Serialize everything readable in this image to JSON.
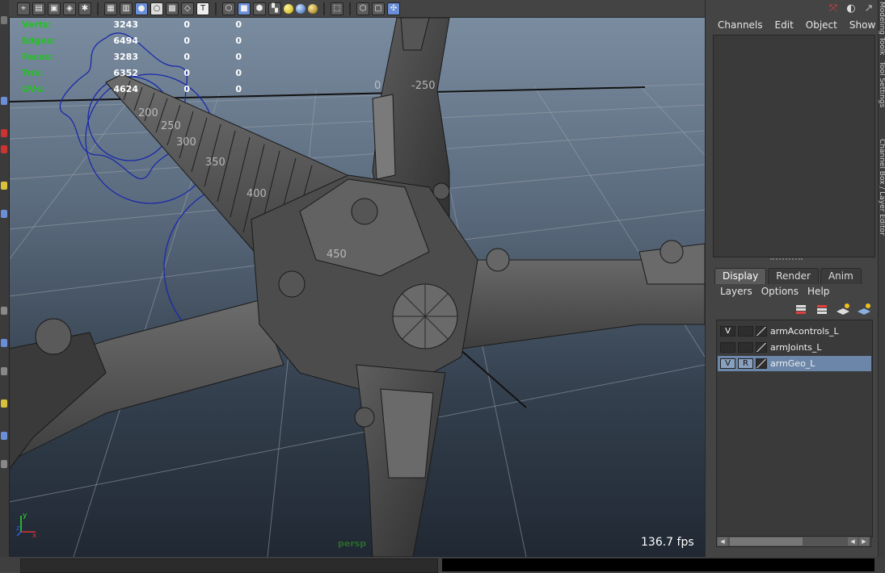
{
  "hud": {
    "stats": [
      {
        "label": "Verts:",
        "v1": "3243",
        "v2": "0",
        "v3": "0"
      },
      {
        "label": "Edges:",
        "v1": "6494",
        "v2": "0",
        "v3": "0"
      },
      {
        "label": "Faces:",
        "v1": "3283",
        "v2": "0",
        "v3": "0"
      },
      {
        "label": "Tris:",
        "v1": "6352",
        "v2": "0",
        "v3": "0"
      },
      {
        "label": "UVs:",
        "v1": "4624",
        "v2": "0",
        "v3": "0"
      }
    ],
    "fps": "136.7 fps",
    "camera": "persp"
  },
  "viewport": {
    "dimension_labels": [
      "-250",
      "250",
      "200",
      "300",
      "350",
      "400",
      "450",
      "0"
    ]
  },
  "toolbar": {
    "icons": [
      "select-camera-icon",
      "bookmark-icon",
      "image-plane-icon",
      "2d-pan-icon",
      "grid-icon",
      "wireframe-icon",
      "smooth-shade-icon",
      "wireframe-on-shaded-icon",
      "xray-icon",
      "texture-icon",
      "use-all-lights-icon",
      "shadows-icon",
      "isolate-select-icon",
      "xray-joints-icon"
    ]
  },
  "channel_box": {
    "menu": [
      "Channels",
      "Edit",
      "Object",
      "Show"
    ]
  },
  "side_tabs": [
    "Modeling Toolkit",
    "Tool Settings",
    "Channel Box / Layer Editor"
  ],
  "layer_editor": {
    "tabs": [
      "Display",
      "Render",
      "Anim"
    ],
    "active_tab": "Display",
    "menu": [
      "Layers",
      "Options",
      "Help"
    ],
    "layers": [
      {
        "v": "V",
        "r": "",
        "name": "armAcontrols_L",
        "selected": false
      },
      {
        "v": "",
        "r": "",
        "name": "armJoints_L",
        "selected": false
      },
      {
        "v": "V",
        "r": "R",
        "name": "armGeo_L",
        "selected": true
      }
    ]
  },
  "colors": {
    "hud_label": "#1fc41f",
    "selected_layer": "#6b86a8",
    "curve_blue": "#1a2aa8"
  }
}
